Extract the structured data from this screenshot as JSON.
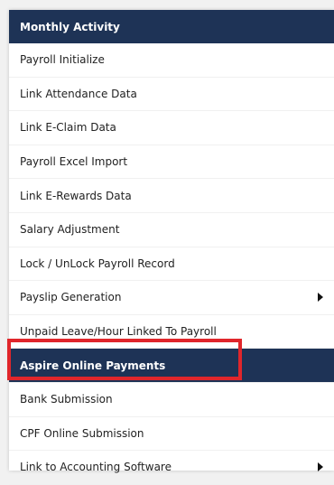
{
  "menu": {
    "header": "Monthly Activity",
    "items": [
      {
        "label": "Payroll Initialize",
        "has_submenu": false
      },
      {
        "label": "Link Attendance Data",
        "has_submenu": false
      },
      {
        "label": "Link E-Claim Data",
        "has_submenu": false
      },
      {
        "label": "Payroll Excel Import",
        "has_submenu": false
      },
      {
        "label": "Link E-Rewards Data",
        "has_submenu": false
      },
      {
        "label": "Salary Adjustment",
        "has_submenu": false
      },
      {
        "label": "Lock / UnLock Payroll Record",
        "has_submenu": false
      },
      {
        "label": "Payslip Generation",
        "has_submenu": true
      },
      {
        "label": "Unpaid Leave/Hour Linked To Payroll",
        "has_submenu": false
      },
      {
        "label": "Aspire Online Payments",
        "has_submenu": false,
        "active": true
      },
      {
        "label": "Bank Submission",
        "has_submenu": false
      },
      {
        "label": "CPF Online Submission",
        "has_submenu": false
      },
      {
        "label": "Link to Accounting Software",
        "has_submenu": true
      }
    ]
  },
  "colors": {
    "header_bg": "#1e3356",
    "active_bg": "#1e3356",
    "highlight_border": "#e0262b"
  },
  "icons": {
    "submenu": "caret-right-icon"
  }
}
